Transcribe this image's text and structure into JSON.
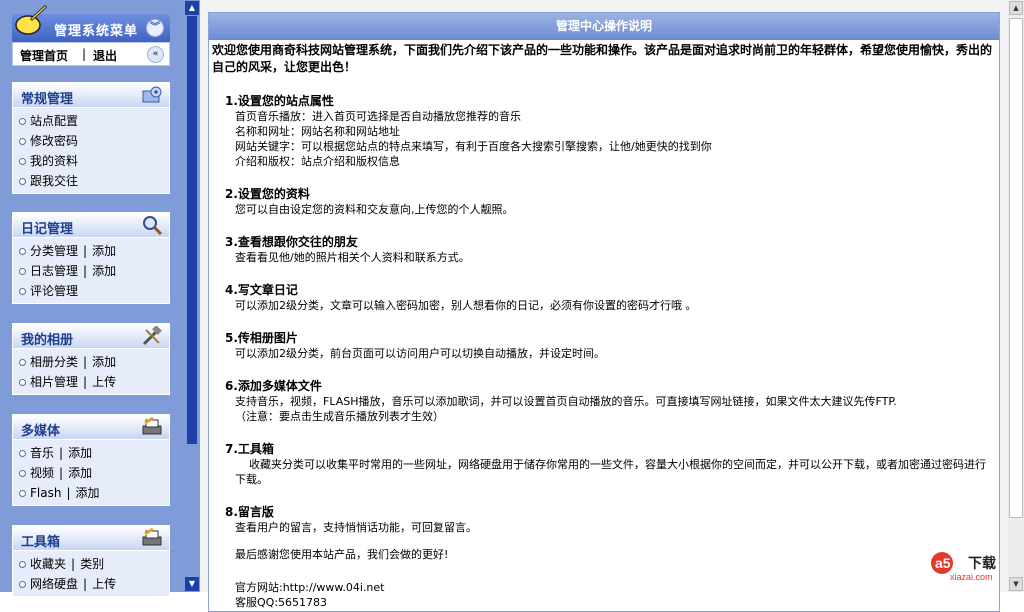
{
  "menu": {
    "title": "管理系统菜单",
    "collapse_icon": "double-chevron-down-icon",
    "quicklinks": {
      "home": "管理首页",
      "sep": "|",
      "logout": "退出",
      "collapse_icon": "double-chevron-left-icon"
    },
    "groups": [
      {
        "title": "常规管理",
        "icon": "settings-folder-icon",
        "items": [
          [
            "站点配置"
          ],
          [
            "修改密码"
          ],
          [
            "我的资料"
          ],
          [
            "跟我交往"
          ]
        ]
      },
      {
        "title": "日记管理",
        "icon": "magnifier-icon",
        "items": [
          [
            "分类管理",
            "添加"
          ],
          [
            "日志管理",
            "添加"
          ],
          [
            "评论管理"
          ]
        ]
      },
      {
        "title": "我的相册",
        "icon": "tools-icon",
        "items": [
          [
            "相册分类",
            "添加"
          ],
          [
            "相片管理",
            "上传"
          ]
        ]
      },
      {
        "title": "多媒体",
        "icon": "printer-icon",
        "items": [
          [
            "音乐",
            "添加"
          ],
          [
            "视频",
            "添加"
          ],
          [
            "Flash",
            "添加"
          ]
        ]
      },
      {
        "title": "工具箱",
        "icon": "printer-icon",
        "items": [
          [
            "收藏夹",
            "类别"
          ],
          [
            "网络硬盘",
            "上传"
          ]
        ]
      }
    ]
  },
  "content": {
    "title": "管理中心操作说明",
    "intro": "欢迎您使用商奇科技网站管理系统，下面我们先介绍下该产品的一些功能和操作。该产品是面对追求时尚前卫的年轻群体，希望您使用愉快，秀出的自己的风采，让您更出色！",
    "sections": [
      {
        "title": "1.设置您的站点属性",
        "lines": [
          "首页音乐播放：进入首页可选择是否自动播放您推荐的音乐",
          "名称和网址：网站名称和网站地址",
          "网站关键字：可以根据您站点的特点来填写，有利于百度各大搜索引擎搜索，让他/她更快的找到你",
          "介绍和版权：站点介绍和版权信息"
        ]
      },
      {
        "title": "2.设置您的资料",
        "lines": [
          "您可以自由设定您的资料和交友意向,上传您的个人靓照。"
        ]
      },
      {
        "title": "3.查看想跟你交往的朋友",
        "lines": [
          "查看看见他/她的照片相关个人资料和联系方式。"
        ]
      },
      {
        "title": "4.写文章日记",
        "lines": [
          " 可以添加2级分类，文章可以输入密码加密，别人想看你的日记，必须有你设置的密码才行哦 。"
        ]
      },
      {
        "title": "5.传相册图片",
        "lines": [
          "可以添加2级分类，前台页面可以访问用户可以切换自动播放，并设定时间。"
        ]
      },
      {
        "title": "6.添加多媒体文件",
        "lines": [
          "支持音乐，视频，FLASH播放，音乐可以添加歌词，并可以设置首页自动播放的音乐。可直接填写网址链接，如果文件太大建议先传FTP.",
          "（注意：要点击生成音乐播放列表才生效）"
        ]
      },
      {
        "title": "7.工具箱",
        "lines": [
          "    收藏夹分类可以收集平时常用的一些网址，网络硬盘用于储存你常用的一些文件，容量大小根据你的空间而定，并可以公开下载，或者加密通过密码进行下载。"
        ]
      },
      {
        "title": "8.留言版",
        "lines": [
          "查看用户的留言，支持悄悄话功能，可回复留言。"
        ]
      }
    ],
    "closing": "最后感谢您使用本站产品，我们会做的更好!",
    "site": "官方网站:http://www.04i.net",
    "qq": "客服QQ:5651783"
  },
  "watermark": {
    "brand": "a5",
    "word": "下载",
    "domain": "xiazai.com"
  },
  "colors": {
    "menu_bg": "#7f9bd8",
    "menu_header": "#3f63c2",
    "group_title": "#1f3f8f",
    "content_title_bg": "#6d8cd2"
  }
}
